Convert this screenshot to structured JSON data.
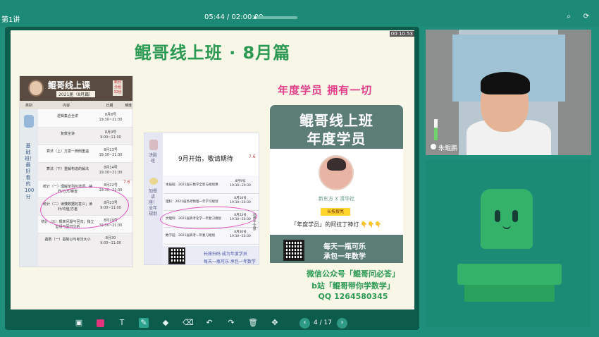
{
  "topbar": {
    "lesson": "第1讲",
    "timer": "05:44 / 02:00:00",
    "progress_fraction": 0.05,
    "icons": [
      "zoom-icon",
      "refresh-icon"
    ]
  },
  "slide": {
    "title": "鲲哥线上班 · 8月篇",
    "corner_time": "00:10.53",
    "card1": {
      "title": "鲲哥线上课",
      "sub": "2021届（8月篇）",
      "tag": "新月 分组 32份",
      "cols": [
        "类别",
        "内容",
        "日期",
        "难度"
      ],
      "left_text": "基础班！最好看的100分",
      "rows": [
        {
          "name": "逻辑集合全讲",
          "date": "8月8号 19:30~21:30"
        },
        {
          "name": "复数全讲",
          "date": "8月9号 9:00~11:00"
        },
        {
          "name": "算法（上）方案一典例重温",
          "date": "8月13号 19:30~21:30"
        },
        {
          "name": "算法（下）重解构造的解法",
          "date": "8月14号 19:30~21:30"
        },
        {
          "name": "统计（一）理解单列与选项，抽样/分方/审查",
          "date": "8月22号 19:30~21:30"
        },
        {
          "name": "统计（二）读懂数据的意义；读针/均值/方差",
          "date": "8月23号 9:00~11:00"
        },
        {
          "name": "统计（三）概率问题与回归；独立型组与回归分析",
          "date": "8月29号 19:30~21:30"
        },
        {
          "name": "函数（一）基础以与考法大小",
          "date": "8月30 9:00~11:00"
        }
      ]
    },
    "card2": {
      "head": "9月开始，敬请期待",
      "left_top": "决胜班",
      "left_bottom": "加餐讲座！全年规划",
      "mark": "7.6",
      "rows": [
        {
          "name": "本届班：2021届三数学全新与规划课",
          "date": "8月9号 19:30~20:30"
        },
        {
          "name": "理科：2021届高考物理一年学习规划",
          "date": "8月16号 19:30~20:30"
        },
        {
          "name": "文理科：2021届高考化学一年复习规划",
          "date": "8月23号 19:30~20:30",
          "edge": "适用于全部"
        },
        {
          "name": "数学班：2021届高考一年复习规划",
          "date": "8月30号 19:30~20:30"
        }
      ],
      "foot_1": "长按扫码 成为年度学员",
      "foot_2": "每天一瓶可乐 承包一年数学"
    },
    "headline": "年度学员 拥有一切",
    "poster": {
      "title": "鲲哥线上班",
      "sub": "年度学员",
      "brand": "新东方 X 清华社",
      "pill": "长按搜亮",
      "line": "「年度学员」的阿拉丁神灯 👇👇👇",
      "foot_1": "每天一瓶可乐",
      "foot_2": "承包一年数学"
    },
    "contacts": [
      "微信公众号「鲲哥问必答」",
      "b站「鲲哥带你学数学」",
      "QQ  1264580345"
    ]
  },
  "toolbar": {
    "tools": [
      "image-icon",
      "color-icon",
      "text-icon",
      "pen-icon",
      "shape-icon",
      "eraser-icon",
      "undo-icon",
      "redo-icon",
      "trash-icon",
      "move-icon"
    ],
    "page": "4 / 17"
  },
  "video": {
    "name": "朱鲲鹏"
  },
  "colors": {
    "accent": "#1f8f7c",
    "title_green": "#2d9a54",
    "pink": "#e23f8b"
  }
}
